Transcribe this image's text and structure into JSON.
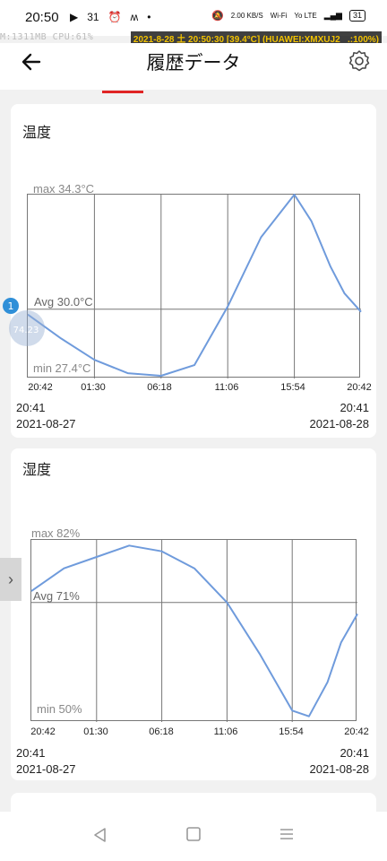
{
  "status": {
    "time": "20:50",
    "left_icons": [
      "▶",
      "31",
      "⏰",
      "ʍ",
      "•"
    ],
    "right_icons": [
      "🔕",
      "2.00 KB/S",
      "Wi-Fi",
      "Yo LTE",
      "▂▄▆"
    ],
    "battery": "31",
    "overlay_left": "M:1311MB  CPU:61%",
    "overlay_right": "2021-8-28 土 20:50:30 [39.4°C] (HUAWEI:XMXUJ2_ .:100%)"
  },
  "appbar": {
    "title": "履歴データ",
    "back_icon": "arrow-left-icon",
    "settings_icon": "gear-icon"
  },
  "float_badge": {
    "count": "1",
    "label": "74.23"
  },
  "side_tab_glyph": "›",
  "colors": {
    "line": "#6f9bdc",
    "accent": "#e02424",
    "badge": "#2f8fd8"
  },
  "charts": [
    {
      "title": "温度",
      "max_label": "max 34.3°C",
      "avg_label": "Avg 30.0°C",
      "min_label": "min 27.4°C",
      "x_ticks": [
        "20:42",
        "01:30",
        "06:18",
        "11:06",
        "15:54",
        "20:42"
      ],
      "start_time": "20:41",
      "start_date": "2021-08-27",
      "end_time": "20:41",
      "end_date": "2021-08-28"
    },
    {
      "title": "湿度",
      "max_label": "max 82%",
      "avg_label": "Avg 71%",
      "min_label": "min 50%",
      "x_ticks": [
        "20:42",
        "01:30",
        "06:18",
        "11:06",
        "15:54",
        "20:42"
      ],
      "start_time": "20:41",
      "start_date": "2021-08-27",
      "end_time": "20:41",
      "end_date": "2021-08-28"
    }
  ],
  "chart_data": [
    {
      "type": "line",
      "title": "温度",
      "xlabel": "",
      "ylabel": "",
      "ylim": [
        27.4,
        34.3
      ],
      "avg": 30.0,
      "x": [
        "20:42",
        "23:06",
        "01:30",
        "03:54",
        "06:18",
        "08:42",
        "11:06",
        "13:30",
        "15:54",
        "17:08",
        "18:30",
        "19:30",
        "20:42"
      ],
      "series": [
        {
          "values": [
            29.8,
            28.9,
            28.1,
            27.6,
            27.5,
            27.9,
            30.1,
            32.7,
            34.3,
            33.3,
            31.6,
            30.6,
            29.9
          ]
        }
      ],
      "grid": true
    },
    {
      "type": "line",
      "title": "湿度",
      "xlabel": "",
      "ylabel": "",
      "ylim": [
        50,
        82
      ],
      "avg": 71,
      "x": [
        "20:42",
        "23:06",
        "01:30",
        "03:54",
        "06:18",
        "08:42",
        "11:06",
        "13:30",
        "15:54",
        "17:08",
        "18:30",
        "19:30",
        "20:42"
      ],
      "series": [
        {
          "values": [
            73,
            77,
            79,
            81,
            80,
            77,
            71,
            62,
            52,
            51,
            57,
            64,
            69
          ]
        }
      ],
      "grid": true
    }
  ]
}
